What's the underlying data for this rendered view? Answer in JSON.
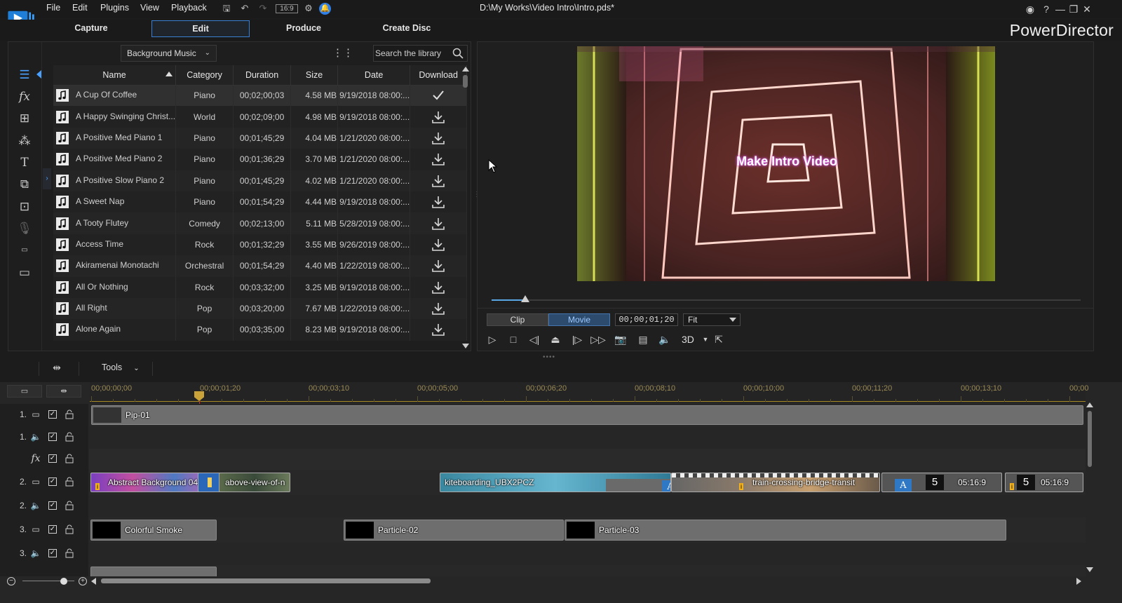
{
  "menu": {
    "file": "File",
    "edit": "Edit",
    "plugins": "Plugins",
    "view": "View",
    "playback": "Playback"
  },
  "toolbar": {
    "aspect": "16:9"
  },
  "document_title": "D:\\My Works\\Video Intro\\Intro.pds*",
  "window_controls": {
    "help": "?"
  },
  "mode_tabs": [
    "Capture",
    "Edit",
    "Produce",
    "Create Disc"
  ],
  "brand": "PowerDirector",
  "library": {
    "filter": "Background Music",
    "search_placeholder": "Search the library",
    "columns": [
      "Name",
      "Category",
      "Duration",
      "Size",
      "Date",
      "Download"
    ],
    "rows": [
      {
        "name": "A Cup Of Coffee",
        "category": "Piano",
        "duration": "00;02;00;03",
        "size": "4.58 MB",
        "date": "9/19/2018 08:00:...",
        "download": "downloaded"
      },
      {
        "name": "A Happy Swinging Christ...",
        "category": "World",
        "duration": "00;02;09;00",
        "size": "4.98 MB",
        "date": "9/19/2018 08:00:...",
        "download": "download"
      },
      {
        "name": "A Positive Med Piano 1",
        "category": "Piano",
        "duration": "00;01;45;29",
        "size": "4.04 MB",
        "date": "1/21/2020 08:00:...",
        "download": "download"
      },
      {
        "name": "A Positive Med Piano 2",
        "category": "Piano",
        "duration": "00;01;36;29",
        "size": "3.70 MB",
        "date": "1/21/2020 08:00:...",
        "download": "download"
      },
      {
        "name": "A Positive Slow Piano 2",
        "category": "Piano",
        "duration": "00;01;45;29",
        "size": "4.02 MB",
        "date": "1/21/2020 08:00:...",
        "download": "download"
      },
      {
        "name": "A Sweet Nap",
        "category": "Piano",
        "duration": "00;01;54;29",
        "size": "4.44 MB",
        "date": "9/19/2018 08:00:...",
        "download": "download"
      },
      {
        "name": "A Tooty Flutey",
        "category": "Comedy",
        "duration": "00;02;13;00",
        "size": "5.11 MB",
        "date": "5/28/2019 08:00:...",
        "download": "download"
      },
      {
        "name": "Access Time",
        "category": "Rock",
        "duration": "00;01;32;29",
        "size": "3.55 MB",
        "date": "9/26/2019 08:00:...",
        "download": "download"
      },
      {
        "name": "Akiramenai Monotachi",
        "category": "Orchestral",
        "duration": "00;01;54;29",
        "size": "4.40 MB",
        "date": "1/22/2019 08:00:...",
        "download": "download"
      },
      {
        "name": "All Or Nothing",
        "category": "Rock",
        "duration": "00;03;32;00",
        "size": "3.25 MB",
        "date": "9/19/2018 08:00:...",
        "download": "download"
      },
      {
        "name": "All Right",
        "category": "Pop",
        "duration": "00;03;20;00",
        "size": "7.67 MB",
        "date": "1/22/2019 08:00:...",
        "download": "download"
      },
      {
        "name": "Alone Again",
        "category": "Pop",
        "duration": "00;03;35;00",
        "size": "8.23 MB",
        "date": "9/19/2018 08:00:...",
        "download": "download"
      }
    ]
  },
  "preview": {
    "overlay_text": "Make Intro Video",
    "mode_clip": "Clip",
    "mode_movie": "Movie",
    "timecode": "00;00;01;20",
    "zoom": "Fit",
    "three_d": "3D",
    "progress_fraction": 0.057
  },
  "timeline_toolbar": {
    "tools": "Tools"
  },
  "ruler": {
    "labels": [
      "00;00;00;00",
      "00;00;01;20",
      "00;00;03;10",
      "00;00;05;00",
      "00;00;06;20",
      "00;00;08;10",
      "00;00;10;00",
      "00;00;11;20",
      "00;00;13;10",
      "00;00"
    ]
  },
  "tracks": {
    "t1v": {
      "num": "1.",
      "clip": "Pip-01"
    },
    "t1a": {
      "num": "1."
    },
    "t2v": {
      "num": "2.",
      "clips": {
        "abstract": "Abstract Background 04",
        "above": "above-view-of-n",
        "kite": "kiteboarding_UBX2PCZ",
        "train": "train-crossing-bridge-transit",
        "title_num_1": "5",
        "title_time_1": "05:16:9",
        "title_num_2": "5",
        "title_time_2": "05:16:9"
      }
    },
    "t2a": {
      "num": "2."
    },
    "t3v": {
      "num": "3.",
      "clips": {
        "smoke": "Colorful Smoke",
        "p2": "Particle-02",
        "p3": "Particle-03"
      }
    },
    "t3a": {
      "num": "3."
    }
  },
  "colors": {
    "accent": "#3a7fd0",
    "playhead": "#e02b2b",
    "ruler_text": "#9b8a55"
  }
}
